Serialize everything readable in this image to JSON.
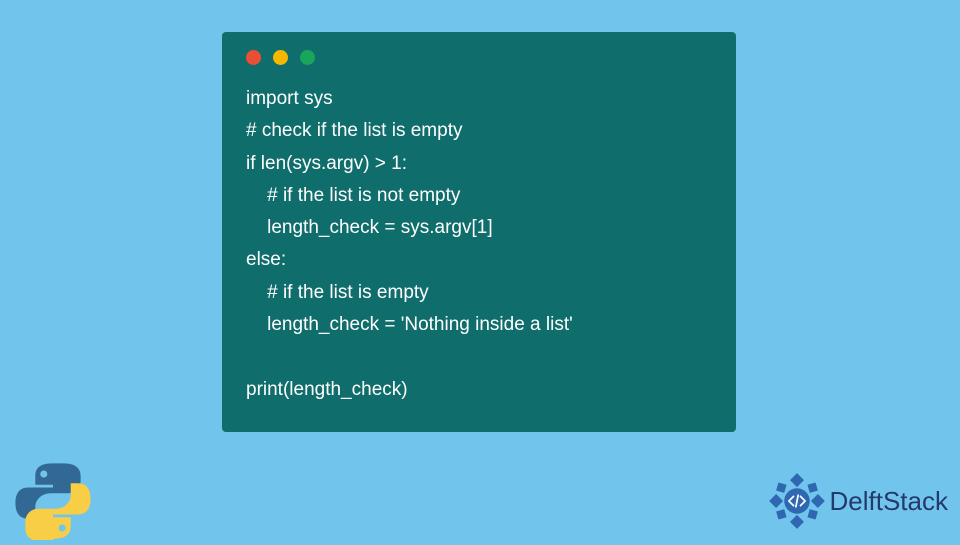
{
  "code": {
    "lines": [
      "import sys",
      "# check if the list is empty",
      "if len(sys.argv) > 1:",
      "    # if the list is not empty",
      "    length_check = sys.argv[1]",
      "else:",
      "    # if the list is empty",
      "    length_check = 'Nothing inside a list'",
      "",
      "print(length_check)"
    ]
  },
  "brand": {
    "name": "DelftStack"
  },
  "colors": {
    "background": "#71c5ed",
    "code_bg": "#0f6d6c",
    "code_text": "#ffffff",
    "dot_red": "#e94f37",
    "dot_yellow": "#f5b700",
    "dot_green": "#1aa55c",
    "brand_text": "#233a6a",
    "python_blue": "#326994",
    "python_yellow": "#f7ce46",
    "delft_icon": "#2f68b0"
  }
}
